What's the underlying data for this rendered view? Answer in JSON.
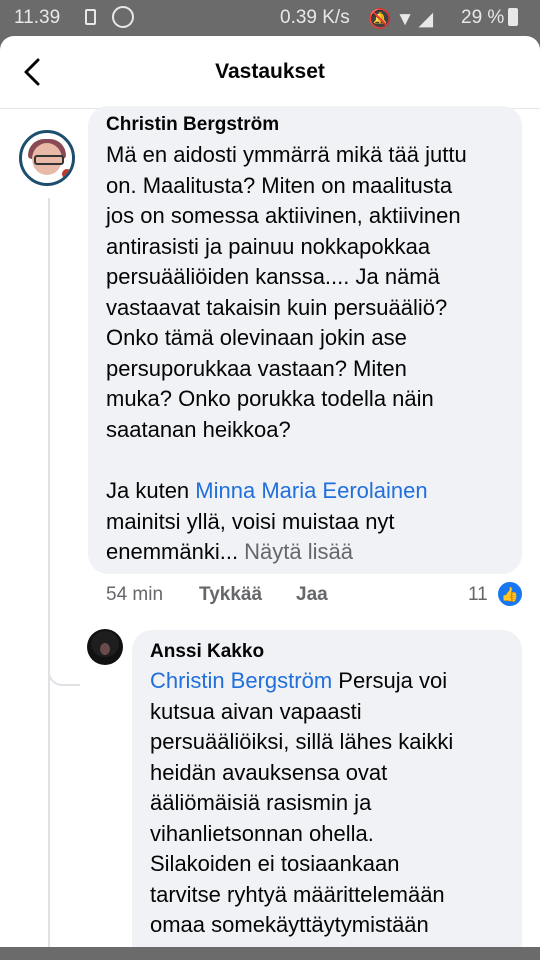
{
  "status_bar": {
    "time": "11.39",
    "speed": "0.39 K/s",
    "battery": "29 %",
    "icons": [
      "sim-icon",
      "whatsapp-icon",
      "mute-icon",
      "wifi-icon",
      "signal-icon",
      "battery-icon"
    ]
  },
  "header": {
    "title": "Vastaukset",
    "back_icon": "chevron-left-icon"
  },
  "comment": {
    "author": "Christin Bergström",
    "text_main": "Mä en aidosti ymmärrä mikä tää juttu\non. Maalitusta? Miten on maalitusta\njos on somessa aktiivinen, aktiivinen\nantirasisti ja painuu nokkapokkaa\npersuääliöiden kanssa.... Ja nämä\nvastaavat takaisin kuin persuääliö?\nOnko tämä olevinaan jokin ase\npersuporukkaa vastaan? Miten\nmuka? Onko porukka todella näin\nsaatanan heikkoa?",
    "text_p2_prefix": "Ja kuten ",
    "text_p2_mention": "Minna Maria Eerolainen",
    "text_p2_suffix": "\nmainitsi yllä, voisi muistaa nyt\nenemmänki... ",
    "see_more": "Näytä lisää",
    "time": "54 min",
    "like_label": "Tykkää",
    "reply_label": "Jaa",
    "reaction_count": "11"
  },
  "reply": {
    "author": "Anssi Kakko",
    "mention": "Christin Bergström",
    "text": " Persuja voi\nkutsua aivan vapaasti\npersuääliöiksi, sillä lähes kaikki\nheidän avauksensa ovat\nääliömäisiä rasismin ja\nvihanlietsonnan ohella.\nSilakoiden ei tosiaankaan\ntarvitse ryhtyä määrittelemään\nomaa somekäyttäytymistään"
  },
  "colors": {
    "link": "#216fdb",
    "bubble": "#f0f2f5",
    "like_badge": "#1877f2",
    "secondary_text": "#65676b"
  }
}
